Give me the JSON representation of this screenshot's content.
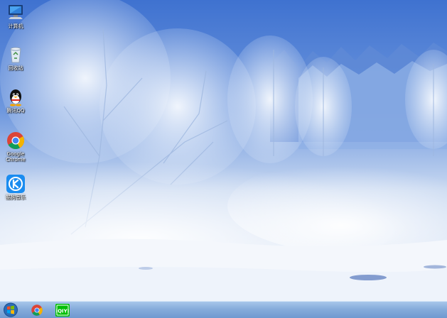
{
  "desktop": {
    "icons": [
      {
        "label": "计算机",
        "icon": "computer-icon"
      },
      {
        "label": "回收站",
        "icon": "recycle-bin-icon"
      },
      {
        "label": "腾讯QQ",
        "icon": "qq-penguin-icon"
      },
      {
        "label": "Google\nChrome",
        "icon": "chrome-icon"
      },
      {
        "label": "酷狗音乐",
        "icon": "kugou-icon"
      }
    ]
  },
  "taskbar": {
    "start_icon": "windows-start-orb-icon",
    "pinned": [
      {
        "name": "Google Chrome",
        "icon": "chrome-icon"
      },
      {
        "name": "iQIYI",
        "icon": "iqiyi-icon",
        "text": "iQIYI"
      }
    ]
  },
  "colors": {
    "taskbar_top": "#a7c6ea",
    "taskbar_bottom": "#6f99d0",
    "sky": "#4f7fd6",
    "snow": "#f3f7fd",
    "iqiyi_green": "#00be06"
  }
}
